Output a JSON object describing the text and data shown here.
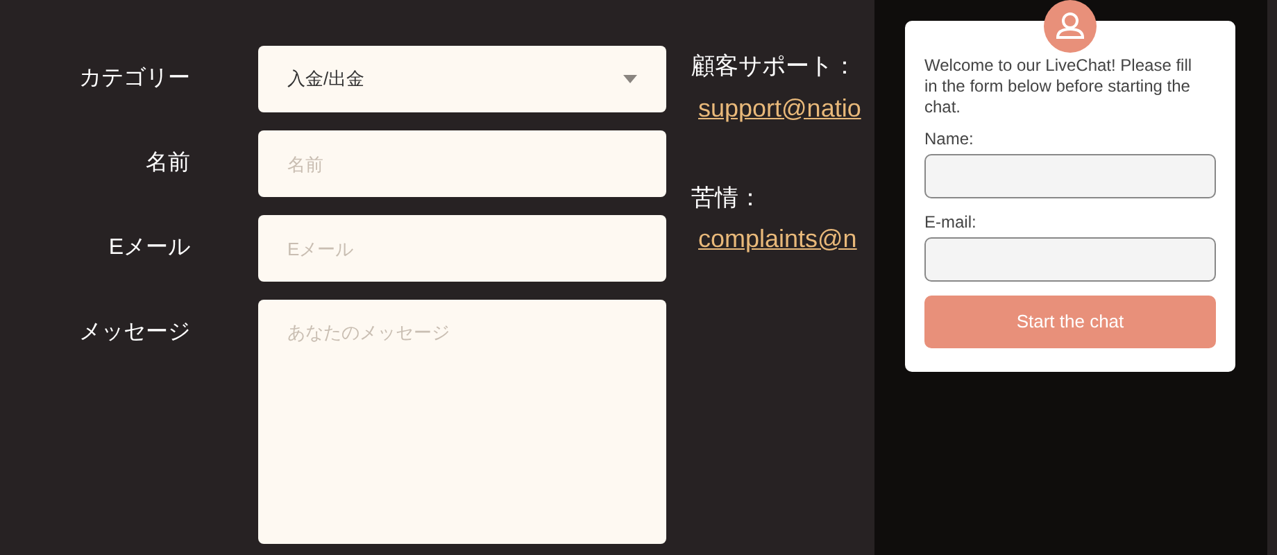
{
  "form": {
    "fields": [
      {
        "label": "カテゴリー",
        "kind": "select",
        "value": "入金/出金"
      },
      {
        "label": "名前",
        "kind": "text",
        "placeholder": "名前"
      },
      {
        "label": "Eメール",
        "kind": "text",
        "placeholder": "Eメール"
      },
      {
        "label": "メッセージ",
        "kind": "textarea",
        "placeholder": "あなたのメッセージ"
      }
    ]
  },
  "contacts": [
    {
      "label": "顧客サポート：",
      "link": "support@natio"
    },
    {
      "label": "苦情：",
      "link": "complaints@n"
    }
  ],
  "livechat": {
    "welcome": "Welcome to our LiveChat! Please fill in the form below before starting the chat.",
    "fields": [
      {
        "label": "Name:"
      },
      {
        "label": "E-mail:"
      }
    ],
    "button": "Start the chat"
  }
}
